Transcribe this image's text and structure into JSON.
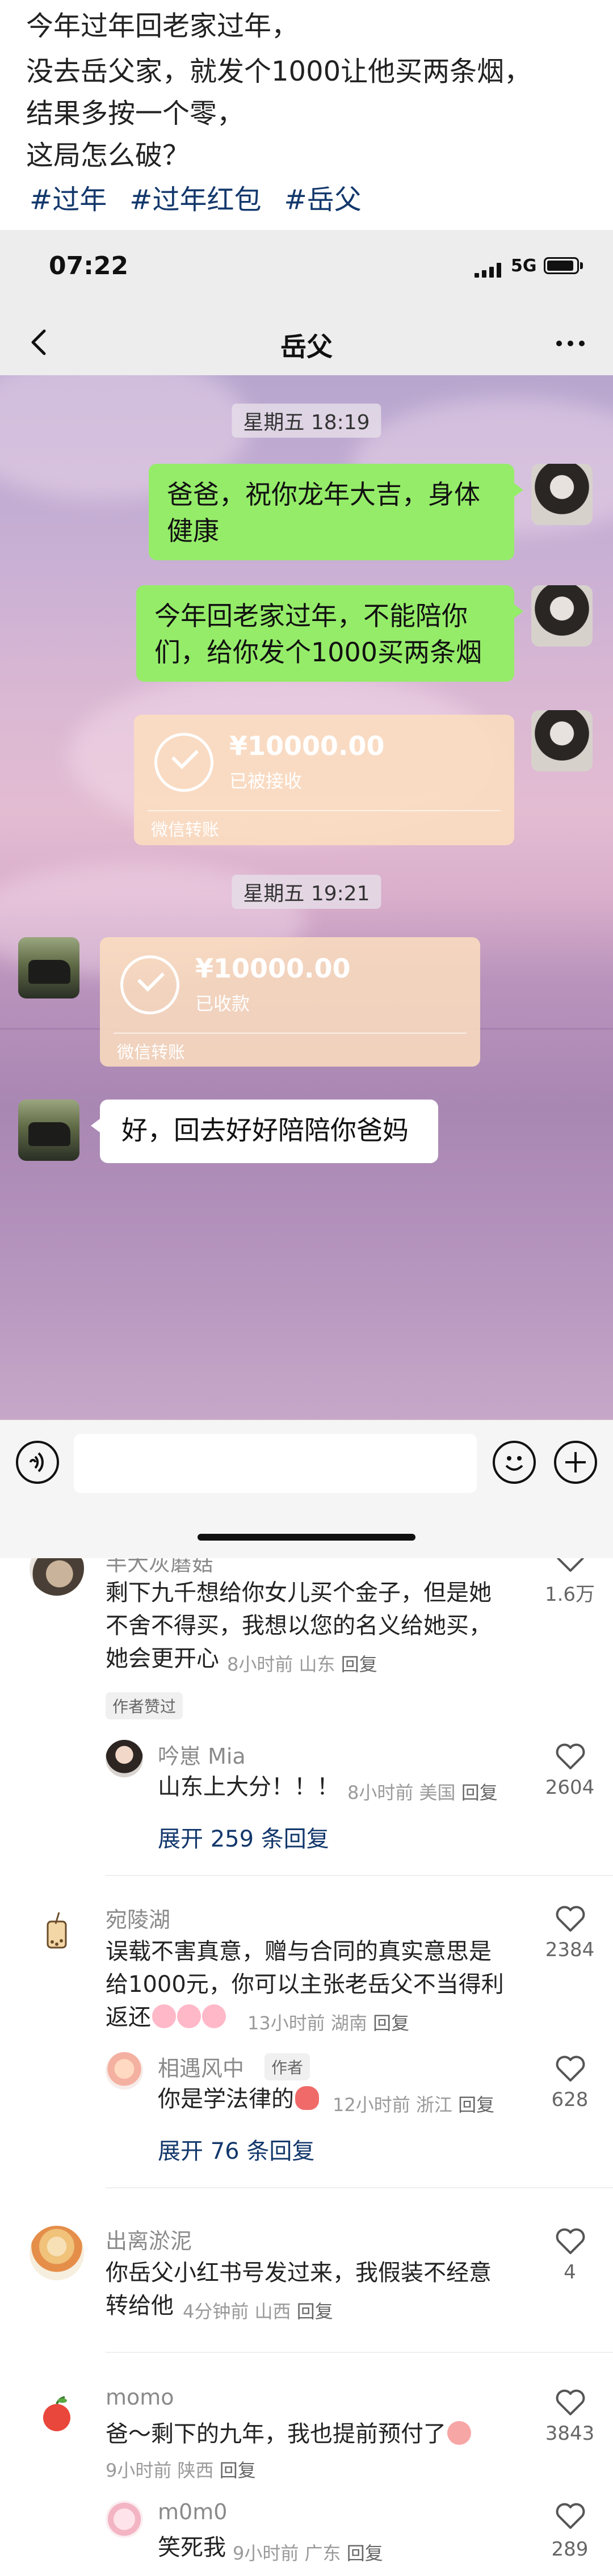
{
  "post": {
    "lines": [
      "今年过年回老家过年，",
      "没去岳父家，就发个1000让他买两条烟，",
      "结果多按一个零，",
      "这局怎么破？"
    ],
    "tags": [
      "#过年",
      "#过年红包",
      "#岳父"
    ]
  },
  "phone": {
    "status_time": "07:22",
    "network": "5G",
    "chat_title": "岳父",
    "messages": {
      "ts1": "星期五 18:19",
      "msg1": "爸爸，祝你龙年大吉，身体健康",
      "msg1_l1": "爸爸，祝你龙年大吉，身体",
      "msg1_l2": "健康",
      "msg2_l1": "今年回老家过年，不能陪你",
      "msg2_l2": "们，给你发个1000买两条烟",
      "transfer1": {
        "amount": "¥10000.00",
        "status": "已被接收",
        "label": "微信转账"
      },
      "ts2": "星期五 19:21",
      "transfer2": {
        "amount": "¥10000.00",
        "status": "已收款",
        "label": "微信转账"
      },
      "reply": "好，回去好好陪陪你爸妈"
    }
  },
  "comments": {
    "c1": {
      "name": "半大灰蘑菇",
      "lines": [
        "剩下九千想给你女儿买个金子，但是她",
        "不舍不得买，我想以您的名义给她买，",
        "她会更开心"
      ],
      "meta": "8小时前 山东",
      "reply": "回复",
      "badge": "作者赞过",
      "likes": "1.6万"
    },
    "c1r": {
      "name": "吟崽 Mia",
      "text": "山东上大分！！！",
      "meta": "8小时前 美国",
      "reply": "回复",
      "likes": "2604",
      "expand": "展开 259 条回复"
    },
    "c2": {
      "name": "宛陵湖",
      "lines": [
        "误载不害真意，赠与合同的真实意思是",
        "给1000元，你可以主张老岳父不当得利"
      ],
      "line3": "返还",
      "meta": "13小时前 湖南",
      "reply": "回复",
      "likes": "2384"
    },
    "c2r": {
      "name": "相遇风中",
      "badge": "作者",
      "text": "你是学法律的",
      "meta": "12小时前 浙江",
      "reply": "回复",
      "likes": "628",
      "expand": "展开 76 条回复"
    },
    "c3": {
      "name": "出离淤泥",
      "lines": [
        "你岳父小红书号发过来，我假装不经意",
        "转给他"
      ],
      "meta": "4分钟前 山西",
      "reply": "回复",
      "likes": "4"
    },
    "c4": {
      "name": "momo",
      "text": "爸～剩下的九年，我也提前预付了",
      "meta": "9小时前 陕西",
      "reply": "回复",
      "likes": "3843"
    },
    "c4r": {
      "name": "m0m0",
      "text": "笑死我",
      "meta": "9小时前 广东",
      "reply": "回复",
      "likes": "289"
    }
  }
}
